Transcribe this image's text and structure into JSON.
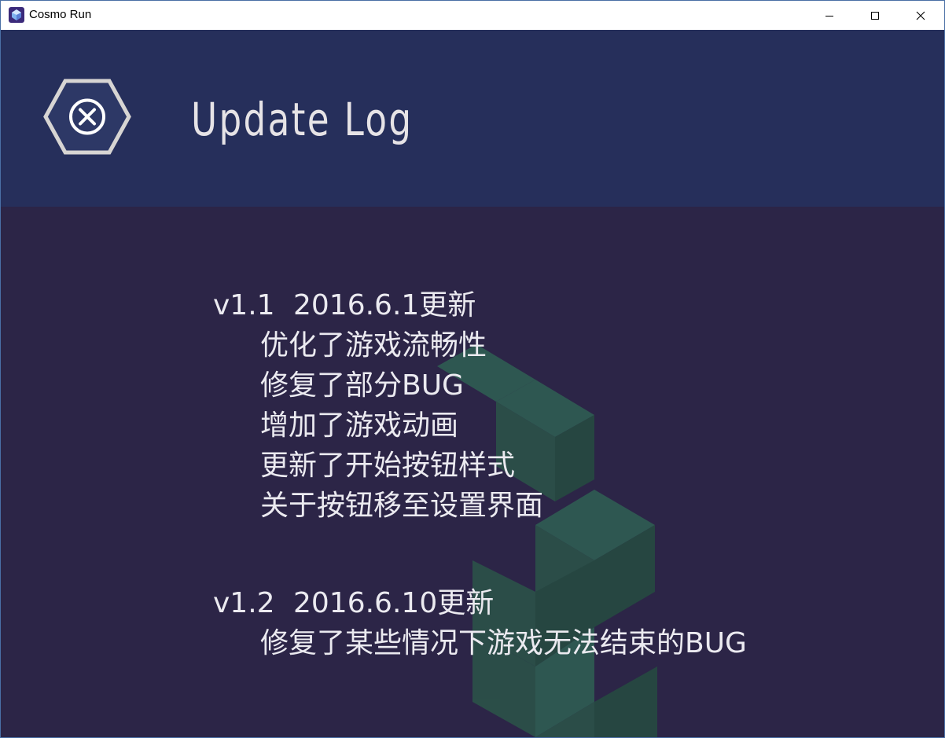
{
  "window": {
    "title": "Cosmo Run",
    "controls": {
      "minimize": "—",
      "maximize": "☐",
      "close": "✕"
    }
  },
  "header": {
    "title": "Update Log",
    "close_icon": "hexagon-close-icon"
  },
  "colors": {
    "header_band": "#262f5b",
    "background": "#2c2547",
    "block_face": "#2f5a52",
    "block_side": "#264841",
    "text": "#ebeaf0",
    "hexagon_outline": "#d7d5d3"
  },
  "updates": [
    {
      "version": "v1.1",
      "date": "2016.6.1更新",
      "changes": [
        "优化了游戏流畅性",
        "修复了部分BUG",
        "增加了游戏动画",
        "更新了开始按钮样式",
        "关于按钮移至设置界面"
      ]
    },
    {
      "version": "v1.2",
      "date": "2016.6.10更新",
      "changes": [
        "修复了某些情况下游戏无法结束的BUG"
      ]
    }
  ]
}
